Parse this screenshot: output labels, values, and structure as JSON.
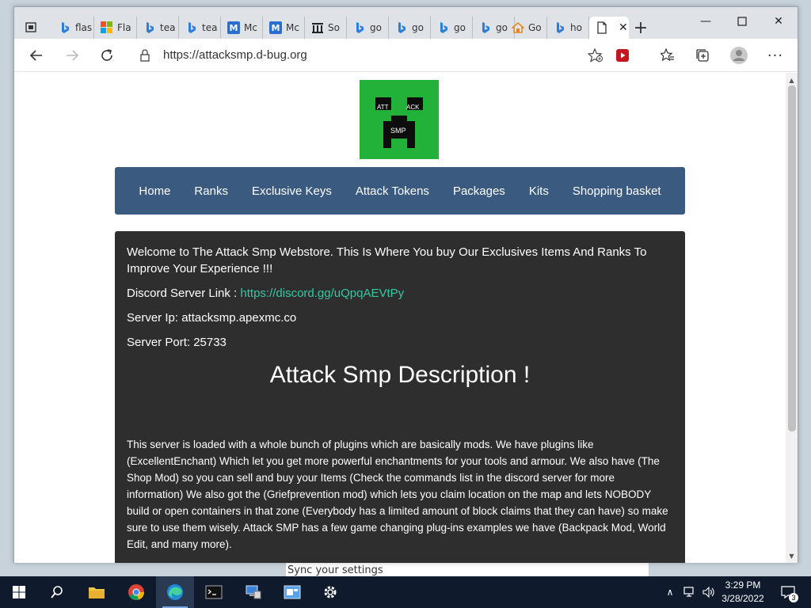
{
  "browser": {
    "tabs": [
      {
        "label": "flas",
        "icon": "bing-icon"
      },
      {
        "label": "Fla",
        "icon": "microsoft-icon"
      },
      {
        "label": "tea",
        "icon": "bing-icon"
      },
      {
        "label": "tea",
        "icon": "bing-icon"
      },
      {
        "label": "Mc",
        "icon": "m-icon"
      },
      {
        "label": "Mc",
        "icon": "m-icon"
      },
      {
        "label": "So",
        "icon": "museum-icon"
      },
      {
        "label": "go",
        "icon": "bing-icon"
      },
      {
        "label": "go",
        "icon": "bing-icon"
      },
      {
        "label": "go",
        "icon": "bing-icon"
      },
      {
        "label": "go",
        "icon": "bing-icon"
      },
      {
        "label": "Go",
        "icon": "home-icon"
      },
      {
        "label": "ho",
        "icon": "bing-icon"
      }
    ],
    "active_tab_icon": "page-icon",
    "address": "https://attacksmp.d-bug.org"
  },
  "page": {
    "logo": {
      "line1_left": "ATT",
      "line1_right": "ACK",
      "line2": "SMP"
    },
    "nav": [
      "Home",
      "Ranks",
      "Exclusive Keys",
      "Attack Tokens",
      "Packages",
      "Kits",
      "Shopping basket"
    ],
    "welcome": "Welcome to The Attack Smp Webstore. This Is Where You buy Our Exclusives Items And Ranks To Improve Your Experience !!!",
    "discord_label": "Discord Server Link :",
    "discord_link": "https://discord.gg/uQpqAEVtPy",
    "server_ip": "Server Ip: attacksmp.apexmc.co",
    "server_port": "Server Port: 25733",
    "heading": "Attack Smp Description !",
    "description": "This server is loaded with a whole bunch of plugins which are basically mods. We have plugins like (ExcellentEnchant) Which let you get more powerful enchantments for your tools and armour. We also have (The Shop Mod) so you can sell and buy your Items (Check the commands list in the discord server for more information) We also got the (Griefprevention mod) which lets you claim location on the map and lets NOBODY build or open containers in that zone (Everybody has a limited amount of block claims that they can have) so make sure to use them wisely. Attack SMP has a few game changing plug-ins examples we have (Backpack Mod, World Edit, and many more)."
  },
  "background_window": {
    "text": "Sync your settings"
  },
  "taskbar": {
    "time": "3:29 PM",
    "date": "3/28/2022",
    "notification_count": "3"
  },
  "colors": {
    "nav_bg": "#3a5a80",
    "content_bg": "#2e2e2e",
    "link": "#34c8a0",
    "logo_green": "#22b23a"
  }
}
